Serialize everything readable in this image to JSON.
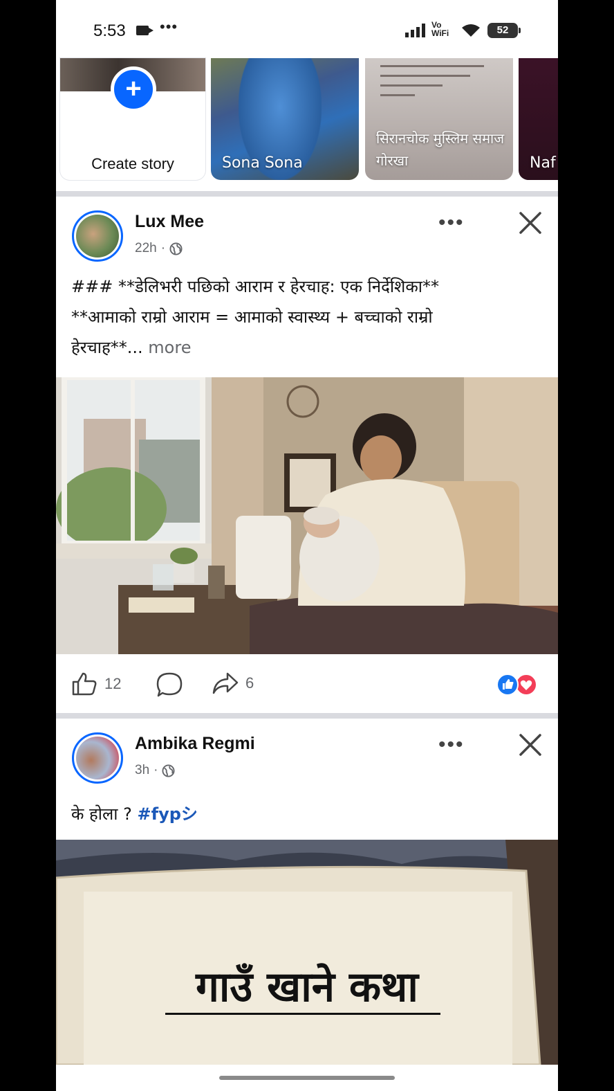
{
  "status_bar": {
    "time": "5:53",
    "vowifi_top": "Vo",
    "vowifi_bottom": "WiFi",
    "battery": "52"
  },
  "stories": [
    {
      "name": "Create story"
    },
    {
      "name": "Sona Sona"
    },
    {
      "name": "सिरानचोक मुस्लिम समाज गोरखा"
    },
    {
      "name": "Naf"
    }
  ],
  "posts": [
    {
      "author": "Lux Mee",
      "time": "22h",
      "text_line1": "### **डेलिभरी पछिको आराम र हेरचाह: एक निर्देशिका**",
      "text_line2": "**आमाको राम्रो आराम = आमाको स्वास्थ्य + बच्चाको राम्रो",
      "text_line3": "हेरचाह**...",
      "more_label": " more",
      "like_count": "12",
      "share_count": "6"
    },
    {
      "author": "Ambika Regmi",
      "time": "3h",
      "text": "के होला ? ",
      "hashtag": "#fypシ",
      "image_title": "गाउँ खाने कथा"
    }
  ],
  "colors": {
    "accent": "#0866ff",
    "like": "#1877f2",
    "love": "#f33e58",
    "muted_text": "#65676b"
  },
  "icons": [
    "camera-icon",
    "signal-icon",
    "wifi-icon",
    "battery-icon",
    "plus-icon",
    "globe-icon",
    "more-options-icon",
    "close-icon",
    "like-icon",
    "comment-icon",
    "share-icon",
    "like-reaction-icon",
    "love-reaction-icon"
  ]
}
